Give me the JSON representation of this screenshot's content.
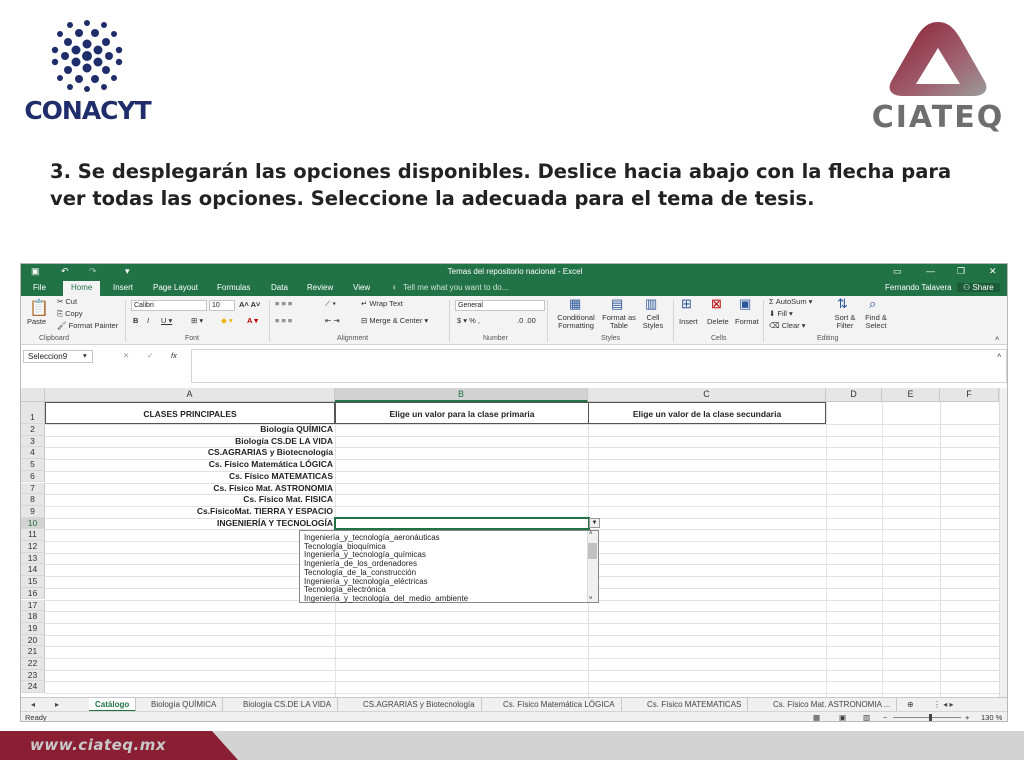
{
  "logos": {
    "left_text": "CONACYT",
    "right_text": "CIATEQ"
  },
  "instruction": "3. Se desplegarán las opciones disponibles. Deslice hacia abajo con la flecha para ver todas las opciones. Seleccione la adecuada para el tema de tesis.",
  "excel": {
    "window_title": "Temas del repositorio nacional - Excel",
    "user": "Fernando Talavera",
    "share": "Share",
    "menu": [
      "File",
      "Home",
      "Insert",
      "Page Layout",
      "Formulas",
      "Data",
      "Review",
      "View"
    ],
    "tell_me": "Tell me what you want to do...",
    "ribbon": {
      "cut": "Cut",
      "copy": "Copy",
      "paste": "Paste",
      "format_painter": "Format Painter",
      "clipboard": "Clipboard",
      "font_name": "Calibri",
      "font_size": "10",
      "font_group": "Font",
      "wrap_text": "Wrap Text",
      "merge_center": "Merge & Center",
      "alignment": "Alignment",
      "number_format": "General",
      "number": "Number",
      "conditional_formatting": "Conditional Formatting",
      "format_as_table": "Format as Table",
      "cell_styles": "Cell Styles",
      "styles": "Styles",
      "insert": "Insert",
      "delete": "Delete",
      "format": "Format",
      "cells": "Cells",
      "autosum": "AutoSum",
      "fill": "Fill",
      "clear": "Clear",
      "sort_filter": "Sort & Filter",
      "find_select": "Find & Select",
      "editing": "Editing"
    },
    "name_box": "Seleccion9",
    "columns": [
      "A",
      "B",
      "C",
      "D",
      "E",
      "F"
    ],
    "rows": [
      "1",
      "2",
      "3",
      "4",
      "5",
      "6",
      "7",
      "8",
      "9",
      "10",
      "11",
      "12",
      "13",
      "14",
      "15",
      "16",
      "17",
      "18",
      "19",
      "20",
      "21",
      "22",
      "23",
      "24"
    ],
    "header_a": "CLASES PRINCIPALES",
    "header_b": "Elige un valor para la clase primaria",
    "header_c": "Elige un valor de la clase secundaria",
    "col_a_values": [
      "Biología QUÍMICA",
      "Biología CS.DE LA VIDA",
      "CS.AGRARIAS y Biotecnología",
      "Cs. Físico Matemática LÓGICA",
      "Cs. Físico MATEMATICAS",
      "Cs. Físico Mat. ASTRONOMIA",
      "Cs. Físico Mat. FISICA",
      "Cs.FísicoMat. TIERRA Y ESPACIO",
      "INGENIERÍA Y TECNOLOGÍA"
    ],
    "dropdown_items": [
      "Ingeniería_y_tecnología_aeronáuticas",
      "Tecnología_bioquímica",
      "Ingeniería_y_tecnología_químicas",
      "Ingeniería_de_los_ordenadores",
      "Tecnología_de_la_construcción",
      "Ingeniería_y_tecnología_eléctricas",
      "Tecnología_electrónica",
      "Ingeniería_y_tecnología_del_medio_ambiente"
    ],
    "sheet_tabs": [
      "Catálogo",
      "Biología QUÍMICA",
      "Biología CS.DE LA VIDA",
      "CS.AGRARIAS y Biotecnología",
      "Cs. Físico Matemática LÓGICA",
      "Cs. Físico MATEMATICAS",
      "Cs. Físico Mat. ASTRONOMIA ..."
    ],
    "status": "Ready",
    "zoom": "130 %"
  },
  "footer": {
    "website": "www.ciateq.mx"
  },
  "colors": {
    "excel_green": "#217346",
    "conacyt_blue": "#1f2d6b",
    "ciateq_maroon": "#8a1f33"
  }
}
